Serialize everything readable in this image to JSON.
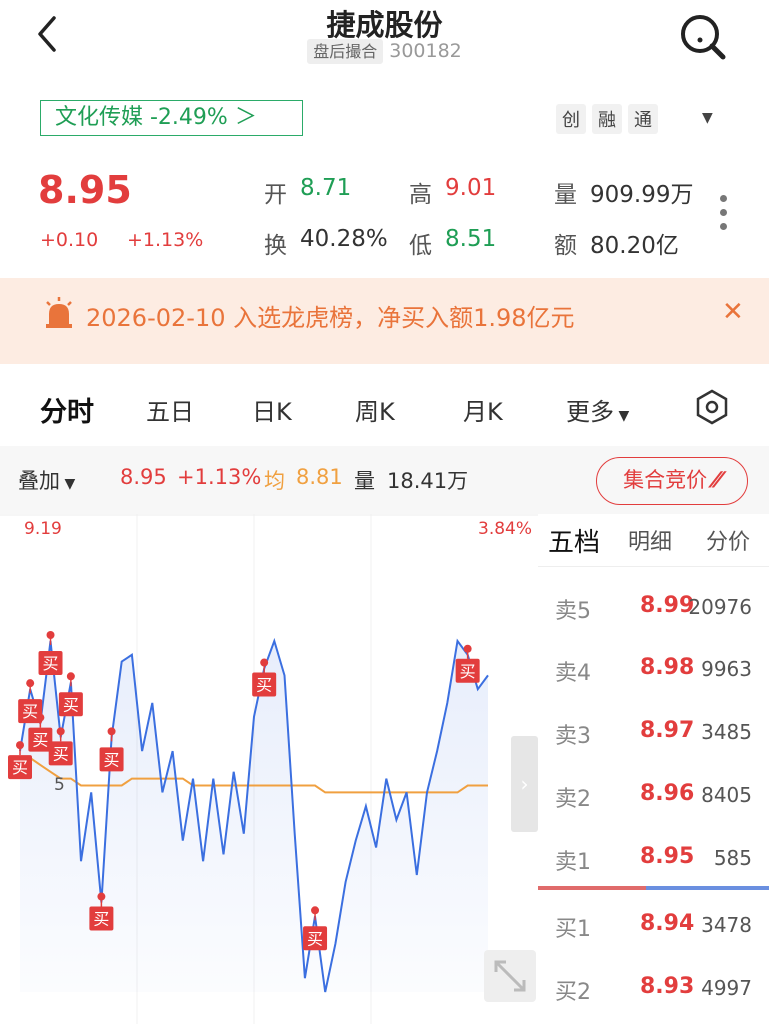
{
  "header": {
    "title": "捷成股份",
    "status_tag": "盘后撮合",
    "code": "300182"
  },
  "sector": {
    "label": "文化传媒 -2.49% ＞"
  },
  "tags": [
    "创",
    "融",
    "通"
  ],
  "quote": {
    "price": "8.95",
    "change": "+0.10",
    "change_pct": "+1.13%",
    "open_label": "开",
    "open": "8.71",
    "high_label": "高",
    "high": "9.01",
    "volume_label": "量",
    "volume": "909.99万",
    "turnover_label": "换",
    "turnover": "40.28%",
    "low_label": "低",
    "low": "8.51",
    "amount_label": "额",
    "amount": "80.20亿"
  },
  "notice": {
    "text": "2026-02-10 入选龙虎榜，净买入额1.98亿元"
  },
  "tabs": [
    "分时",
    "五日",
    "日K",
    "周K",
    "月K",
    "更多"
  ],
  "overlay": {
    "label": "叠加",
    "price": "8.95",
    "pct": "+1.13%",
    "avg_label": "均",
    "avg": "8.81",
    "vol_label": "量",
    "vol": "18.41万",
    "auction_button": "集合竞价"
  },
  "chart": {
    "y_top": "9.19",
    "pct_top": "3.84%",
    "partial_label": "5",
    "marker_label": "买"
  },
  "chart_data": {
    "type": "line",
    "series": [
      {
        "values": [
          8.86,
          8.95,
          8.9,
          9.02,
          8.88,
          8.96,
          8.7,
          8.8,
          8.64,
          8.88,
          8.99,
          9.0,
          8.86,
          8.93,
          8.8,
          8.86,
          8.73,
          8.82,
          8.7,
          8.82,
          8.71,
          8.83,
          8.74,
          8.91,
          8.98,
          9.02,
          8.97,
          8.74,
          8.53,
          8.62,
          8.51,
          8.58,
          8.67,
          8.73,
          8.78,
          8.72,
          8.82,
          8.76,
          8.8,
          8.68,
          8.8,
          8.86,
          8.93,
          9.02,
          9.0,
          8.95,
          8.97
        ]
      },
      {
        "values": [
          8.84,
          8.85,
          8.84,
          8.83,
          8.82,
          8.82,
          8.81,
          8.81,
          8.81,
          8.81,
          8.81,
          8.82,
          8.82,
          8.82,
          8.82,
          8.82,
          8.82,
          8.81,
          8.81,
          8.81,
          8.81,
          8.81,
          8.81,
          8.81,
          8.81,
          8.81,
          8.81,
          8.81,
          8.81,
          8.81,
          8.8,
          8.8,
          8.8,
          8.8,
          8.8,
          8.8,
          8.8,
          8.8,
          8.8,
          8.8,
          8.8,
          8.8,
          8.8,
          8.8,
          8.81,
          8.81,
          8.81
        ]
      }
    ],
    "ylim": [
      8.51,
      9.19
    ],
    "colors": {
      "price": "#3b6fe0",
      "avg": "#f0a040"
    }
  },
  "order_book": {
    "tabs": [
      "五档",
      "明细",
      "分价"
    ],
    "asks": [
      {
        "label": "卖5",
        "price": "8.99",
        "vol": "20976"
      },
      {
        "label": "卖4",
        "price": "8.98",
        "vol": "9963"
      },
      {
        "label": "卖3",
        "price": "8.97",
        "vol": "3485"
      },
      {
        "label": "卖2",
        "price": "8.96",
        "vol": "8405"
      },
      {
        "label": "卖1",
        "price": "8.95",
        "vol": "585"
      }
    ],
    "bids": [
      {
        "label": "买1",
        "price": "8.94",
        "vol": "3478"
      },
      {
        "label": "买2",
        "price": "8.93",
        "vol": "4997"
      }
    ]
  },
  "colors": {
    "up": "#e23d3d",
    "down": "#1f9e55",
    "accent": "#e9743b"
  },
  "icons": [
    "back-arrow-icon",
    "search-icon",
    "alarm-icon",
    "close-icon",
    "settings-hexagon-icon",
    "expand-icon"
  ]
}
